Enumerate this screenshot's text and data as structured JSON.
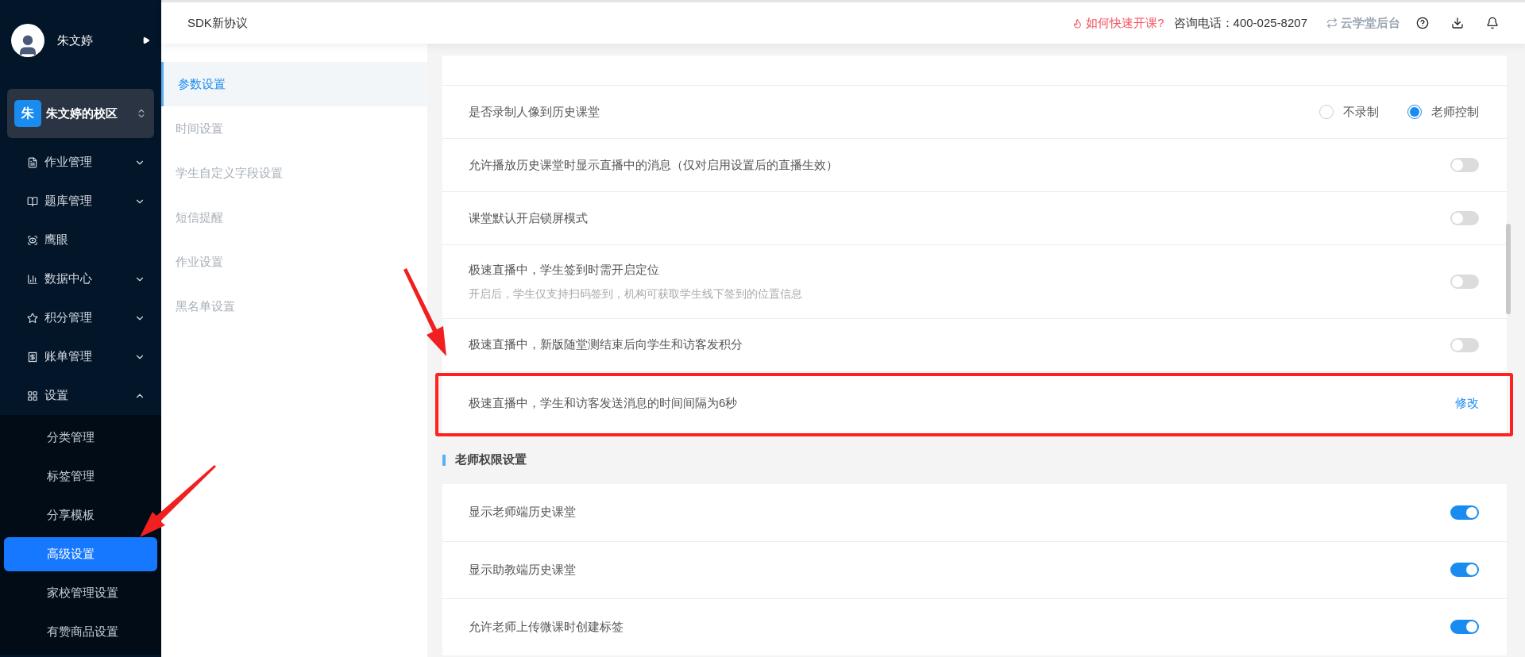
{
  "user": {
    "name": "朱文婷"
  },
  "school": {
    "badge": "朱",
    "name": "朱文婷的校区"
  },
  "menu": [
    {
      "label": "作业管理",
      "expandable": true,
      "expanded": false
    },
    {
      "label": "题库管理",
      "expandable": true,
      "expanded": false
    },
    {
      "label": "鹰眼",
      "expandable": false
    },
    {
      "label": "数据中心",
      "expandable": true,
      "expanded": false
    },
    {
      "label": "积分管理",
      "expandable": true,
      "expanded": false
    },
    {
      "label": "账单管理",
      "expandable": true,
      "expanded": false
    },
    {
      "label": "设置",
      "expandable": true,
      "expanded": true,
      "children": [
        {
          "label": "分类管理",
          "selected": false
        },
        {
          "label": "标签管理",
          "selected": false
        },
        {
          "label": "分享模板",
          "selected": false
        },
        {
          "label": "高级设置",
          "selected": true
        },
        {
          "label": "家校管理设置",
          "selected": false
        },
        {
          "label": "有赞商品设置",
          "selected": false
        }
      ]
    }
  ],
  "topbar": {
    "title": "SDK新协议",
    "quick_link": "如何快速开课?",
    "phone_label": "咨询电话：",
    "phone": "400-025-8207",
    "backend_link": "云学堂后台"
  },
  "subnav": [
    {
      "label": "参数设置",
      "selected": true
    },
    {
      "label": "时间设置",
      "selected": false
    },
    {
      "label": "学生自定义字段设置",
      "selected": false
    },
    {
      "label": "短信提醒",
      "selected": false
    },
    {
      "label": "作业设置",
      "selected": false
    },
    {
      "label": "黑名单设置",
      "selected": false
    }
  ],
  "settings": [
    {
      "kind": "radio",
      "label": "是否录制人像到历史课堂",
      "options": [
        {
          "label": "不录制",
          "selected": false
        },
        {
          "label": "老师控制",
          "selected": true
        }
      ]
    },
    {
      "kind": "toggle",
      "label": "允许播放历史课堂时显示直播中的消息（仅对启用设置后的直播生效）",
      "on": false
    },
    {
      "kind": "toggle",
      "label": "课堂默认开启锁屏模式",
      "on": false
    },
    {
      "kind": "toggle",
      "label": "极速直播中，学生签到时需开启定位",
      "description": "开启后，学生仅支持扫码签到，机构可获取学生线下签到的位置信息",
      "on": false
    },
    {
      "kind": "toggle",
      "label": "极速直播中，新版随堂测结束后向学生和访客发积分",
      "on": false
    },
    {
      "kind": "link",
      "label": "极速直播中，学生和访客发送消息的时间间隔为6秒",
      "action": "修改",
      "highlighted": true
    }
  ],
  "teacher_section": {
    "title": "老师权限设置",
    "settings": [
      {
        "kind": "toggle",
        "label": "显示老师端历史课堂",
        "on": true
      },
      {
        "kind": "toggle",
        "label": "显示助教端历史课堂",
        "on": true
      },
      {
        "kind": "toggle",
        "label": "允许老师上传微课时创建标签",
        "on": true
      }
    ]
  }
}
